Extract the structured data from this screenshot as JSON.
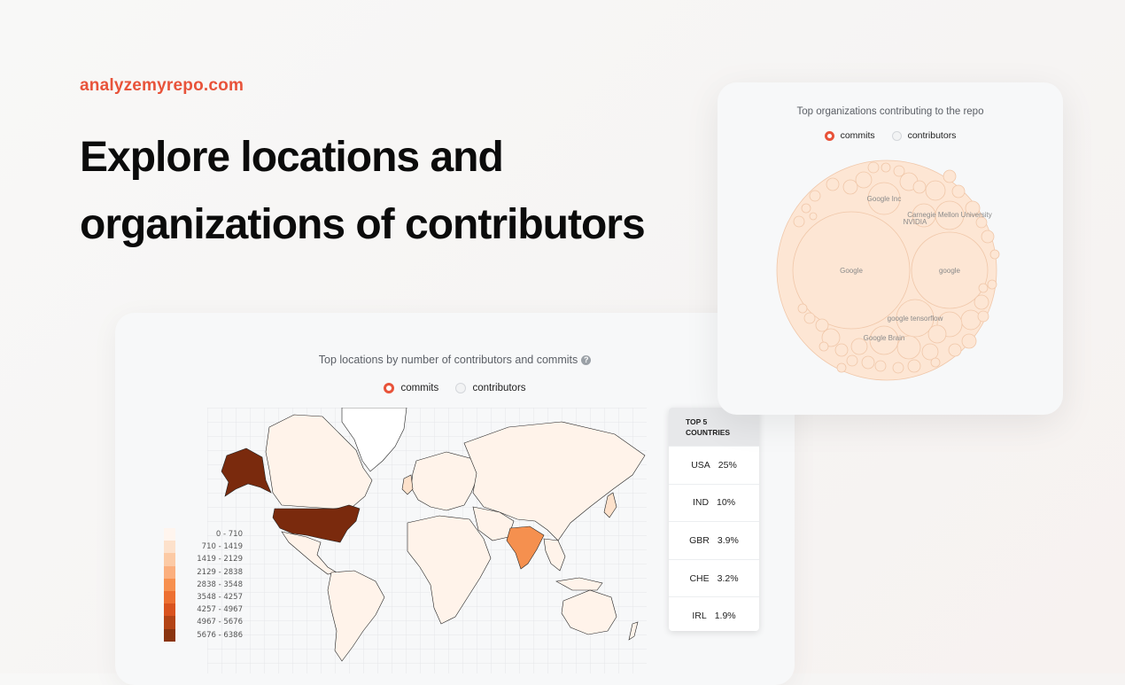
{
  "brand": "analyzemyrepo.com",
  "hero": {
    "line1": "Explore locations and",
    "line2": "organizations of contributors"
  },
  "map_card": {
    "title": "Top locations by number of contributors and commits",
    "help_icon": "?",
    "radio": {
      "commits": "commits",
      "contributors": "contributors",
      "selected": "commits"
    },
    "legend": [
      {
        "label": "0 - 710",
        "color": "#fff5ee"
      },
      {
        "label": "710 - 1419",
        "color": "#fde1cb"
      },
      {
        "label": "1419 - 2129",
        "color": "#fccaa5"
      },
      {
        "label": "2129 - 2838",
        "color": "#fbaf7e"
      },
      {
        "label": "2838 - 3548",
        "color": "#f7904f"
      },
      {
        "label": "3548 - 4257",
        "color": "#ed7032"
      },
      {
        "label": "4257 - 4967",
        "color": "#d9531f"
      },
      {
        "label": "4967 - 5676",
        "color": "#b34416"
      },
      {
        "label": "5676 - 6386",
        "color": "#8a3510"
      }
    ],
    "top5": {
      "header_line1": "TOP 5",
      "header_line2": "COUNTRIES",
      "rows": [
        {
          "country": "USA",
          "pct": "25%"
        },
        {
          "country": "IND",
          "pct": "10%"
        },
        {
          "country": "GBR",
          "pct": "3.9%"
        },
        {
          "country": "CHE",
          "pct": "3.2%"
        },
        {
          "country": "IRL",
          "pct": "1.9%"
        }
      ]
    },
    "colors": {
      "usa": "#7a2a0d",
      "alaska": "#7a2a0d",
      "india": "#f5904f",
      "default": "#fff3ea"
    }
  },
  "org_card": {
    "title": "Top organizations contributing to the repo",
    "radio": {
      "commits": "commits",
      "contributors": "contributors",
      "selected": "commits"
    },
    "labels": {
      "google_inc": "Google Inc",
      "cmu": "Carnegie Mellon University",
      "nvidia": "NVIDIA",
      "google": "Google",
      "google_lower": "google",
      "google_tensorflow": "google tensorflow",
      "google_brain": "Google Brain"
    },
    "bubble_fill": "#fde6d4",
    "bubble_stroke": "#f0c7a9"
  }
}
